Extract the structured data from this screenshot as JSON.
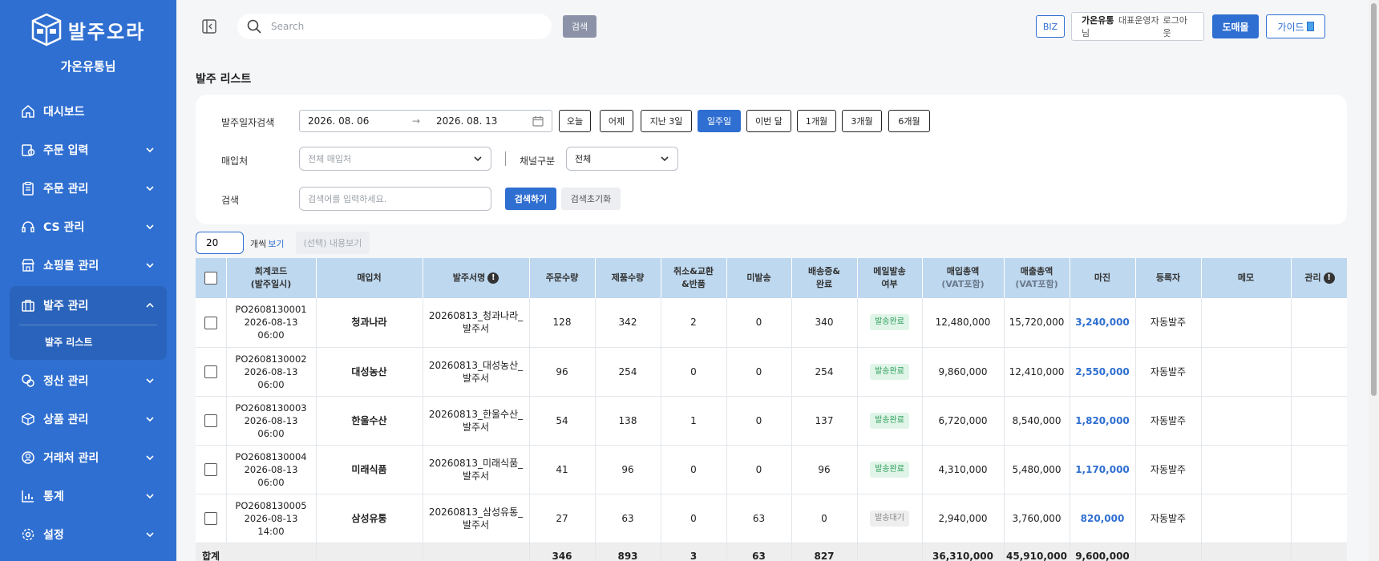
{
  "brand": {
    "logo_text": "발주오라",
    "user_name": "가온유통님"
  },
  "sidebar": {
    "items": [
      {
        "label": "대시보드",
        "icon": "home-icon"
      },
      {
        "label": "주문 입력",
        "icon": "order-input-icon"
      },
      {
        "label": "주문 관리",
        "icon": "clipboard-icon"
      },
      {
        "label": "CS 관리",
        "icon": "headset-icon"
      },
      {
        "label": "쇼핑몰 관리",
        "icon": "store-icon"
      },
      {
        "label": "발주 관리",
        "icon": "briefcase-icon"
      },
      {
        "label": "정산 관리",
        "icon": "settlement-icon"
      },
      {
        "label": "상품 관리",
        "icon": "box-icon"
      },
      {
        "label": "거래처 관리",
        "icon": "partner-icon"
      },
      {
        "label": "통계",
        "icon": "chart-icon"
      },
      {
        "label": "설정",
        "icon": "gear-icon"
      }
    ],
    "active_submenu": "발주 리스트"
  },
  "topbar": {
    "search_placeholder": "Search",
    "search_button": "검색",
    "biz_badge": "BIZ",
    "company": "가온유통",
    "role": "대표운영자님",
    "logout": "로그아웃",
    "wholesale_button": "도매몰",
    "guide_button": "가이드"
  },
  "page": {
    "title": "발주 리스트"
  },
  "filters": {
    "date_label": "발주일자검색",
    "date_from": "2026. 08. 06",
    "date_to": "2026. 08. 13",
    "quick_ranges": [
      "오늘",
      "어제",
      "지난 3일",
      "일주일",
      "이번 달",
      "1개월",
      "3개월",
      "6개월"
    ],
    "active_range": "일주일",
    "supplier_label": "매입처",
    "supplier_placeholder": "전체 매입처",
    "channel_label": "채널구분",
    "channel_value": "전체",
    "keyword_label": "검색",
    "keyword_placeholder": "검색어를 입력하세요.",
    "search_button": "검색하기",
    "reset_button": "검색초기화"
  },
  "list_controls": {
    "page_size": "20",
    "per_label": "개씩",
    "view_label": "보기",
    "content_view_button": "(선택) 내용보기"
  },
  "table": {
    "headers": {
      "code": "회계코드",
      "code_sub": "(발주일시)",
      "supplier": "매입처",
      "doc_name": "발주서명",
      "order_qty": "주문수량",
      "product_qty": "제품수량",
      "cancel_1": "취소&교환",
      "cancel_2": "&반품",
      "unshipped": "미발송",
      "shipping_1": "배송중&",
      "shipping_2": "완료",
      "mail_1": "메일발송",
      "mail_2": "여부",
      "purchase": "매입총액",
      "purchase_sub": "(VAT포함)",
      "sales": "매출총액",
      "sales_sub": "(VAT포함)",
      "margin": "마진",
      "registrant": "등록자",
      "memo": "메모",
      "manage": "관리"
    },
    "rows": [
      {
        "code": "PO2608130001",
        "date": "2026-08-13",
        "time": "06:00",
        "supplier": "청과나라",
        "doc_1": "20260813_청과나라_",
        "doc_2": "발주서",
        "order_qty": "128",
        "product_qty": "342",
        "cancel": "2",
        "unshipped": "0",
        "shipped": "340",
        "mail_status": "발송완료",
        "mail_state": "done",
        "purchase": "12,480,000",
        "sales": "15,720,000",
        "margin": "3,240,000",
        "registrant": "자동발주",
        "memo": ""
      },
      {
        "code": "PO2608130002",
        "date": "2026-08-13",
        "time": "06:00",
        "supplier": "대성농산",
        "doc_1": "20260813_대성농산_",
        "doc_2": "발주서",
        "order_qty": "96",
        "product_qty": "254",
        "cancel": "0",
        "unshipped": "0",
        "shipped": "254",
        "mail_status": "발송완료",
        "mail_state": "done",
        "purchase": "9,860,000",
        "sales": "12,410,000",
        "margin": "2,550,000",
        "registrant": "자동발주",
        "memo": ""
      },
      {
        "code": "PO2608130003",
        "date": "2026-08-13",
        "time": "06:00",
        "supplier": "한울수산",
        "doc_1": "20260813_한울수산_",
        "doc_2": "발주서",
        "order_qty": "54",
        "product_qty": "138",
        "cancel": "1",
        "unshipped": "0",
        "shipped": "137",
        "mail_status": "발송완료",
        "mail_state": "done",
        "purchase": "6,720,000",
        "sales": "8,540,000",
        "margin": "1,820,000",
        "registrant": "자동발주",
        "memo": ""
      },
      {
        "code": "PO2608130004",
        "date": "2026-08-13",
        "time": "06:00",
        "supplier": "미래식품",
        "doc_1": "20260813_미래식품_",
        "doc_2": "발주서",
        "order_qty": "41",
        "product_qty": "96",
        "cancel": "0",
        "unshipped": "0",
        "shipped": "96",
        "mail_status": "발송완료",
        "mail_state": "done",
        "purchase": "4,310,000",
        "sales": "5,480,000",
        "margin": "1,170,000",
        "registrant": "자동발주",
        "memo": ""
      },
      {
        "code": "PO2608130005",
        "date": "2026-08-13",
        "time": "14:00",
        "supplier": "삼성유통",
        "doc_1": "20260813_삼성유통_",
        "doc_2": "발주서",
        "order_qty": "27",
        "product_qty": "63",
        "cancel": "0",
        "unshipped": "63",
        "shipped": "0",
        "mail_status": "발송대기",
        "mail_state": "wait",
        "purchase": "2,940,000",
        "sales": "3,760,000",
        "margin": "820,000",
        "registrant": "자동발주",
        "memo": ""
      }
    ],
    "total": {
      "label": "합계",
      "order_qty": "346",
      "product_qty": "893",
      "cancel": "3",
      "unshipped": "63",
      "shipped": "827",
      "purchase": "36,310,000",
      "sales": "45,910,000",
      "margin": "9,600,000"
    }
  },
  "colors": {
    "primary": "#2f6fd1",
    "header_bg": "#bed8ef",
    "sidebar_bg": "#2f6fd1"
  }
}
